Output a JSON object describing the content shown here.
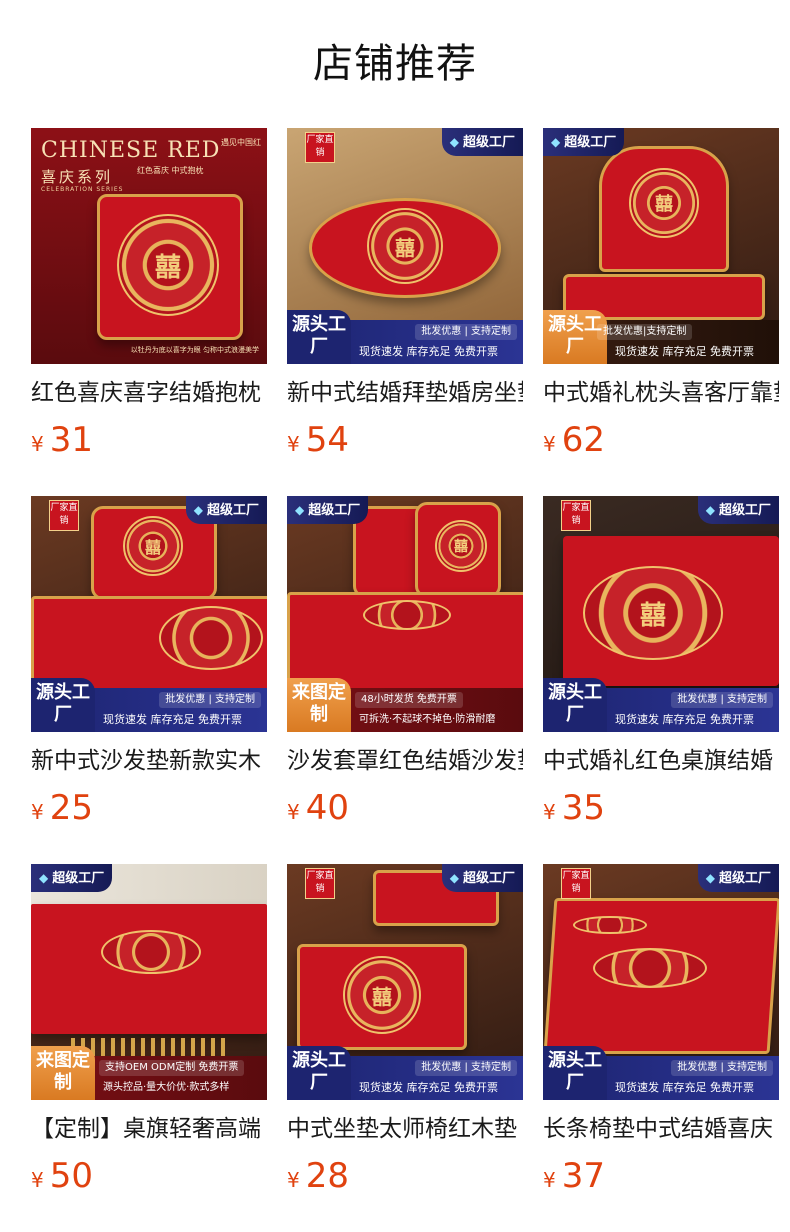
{
  "page": {
    "title": "店铺推荐"
  },
  "colors": {
    "price": "#e0420f",
    "product_red": "#c8141f",
    "badge_navy": "#1d2470",
    "badge_orange": "#e08a2e"
  },
  "badges": {
    "maker": "厂家直销",
    "factory": "超级工厂",
    "factory_icon": "diamond-icon",
    "source": "源头工厂",
    "custom": "来图定制",
    "perk_a": "批发优惠 | 支持定制",
    "perk_b": "现货速发 库存充足 免费开票"
  },
  "currency": "¥",
  "products": [
    {
      "name": "红色喜庆喜字结婚抱枕",
      "price": "31",
      "poster": {
        "title": "CHINESE RED",
        "subtitle": "喜庆系列",
        "tagline": "CELEBRATION SERIES",
        "side": "红色喜庆 中式抱枕",
        "corner": "遇见中国红",
        "caption": "以牡丹为底以喜字为眼 匀称中式浪漫美学"
      }
    },
    {
      "name": "新中式结婚拜垫婚房坐垫",
      "price": "54"
    },
    {
      "name": "中式婚礼枕头喜客厅靠垫",
      "price": "62",
      "perk_a": "批发优惠|支持定制"
    },
    {
      "name": "新中式沙发垫新款实木",
      "price": "25"
    },
    {
      "name": "沙发套罩红色结婚沙发垫",
      "price": "40",
      "perk_a": "48小时发货 免费开票",
      "perk_b": "可拆洗·不起球不掉色·防滑耐磨"
    },
    {
      "name": "中式婚礼红色桌旗结婚",
      "price": "35"
    },
    {
      "name": "【定制】桌旗轻奢高端",
      "price": "50",
      "perk_a": "支持OEM ODM定制 免费开票",
      "perk_b": "源头控品·量大价优·款式多样"
    },
    {
      "name": "中式坐垫太师椅红木垫",
      "price": "28"
    },
    {
      "name": "长条椅垫中式结婚喜庆",
      "price": "37"
    }
  ]
}
